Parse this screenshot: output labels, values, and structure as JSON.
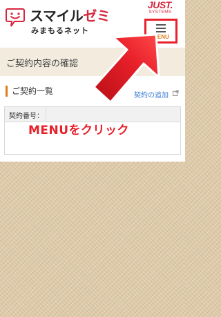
{
  "header": {
    "logo_title_black": "スマイル",
    "logo_title_red": "ゼミ",
    "logo_subtitle": "みまもるネット",
    "brand_main": "JUST.",
    "brand_sub": "SYSTEMS",
    "menu_label": "MENU"
  },
  "page": {
    "title": "ご契約内容の確認",
    "section_heading": "ご契約一覧",
    "add_link": "契約の追加",
    "table_header_label": "契約番号："
  },
  "annotation": {
    "instruction": "MENUをクリック"
  },
  "colors": {
    "accent_red": "#e8202a",
    "brand_red": "#d7263d",
    "orange": "#e07b14",
    "link_blue": "#3a7bd5",
    "background_tan": "#e0ccaa"
  },
  "icons": {
    "logo": "smile-speech-bubble-icon",
    "menu": "hamburger-menu-icon",
    "external_link": "external-link-icon",
    "arrow": "pointer-arrow-icon"
  }
}
